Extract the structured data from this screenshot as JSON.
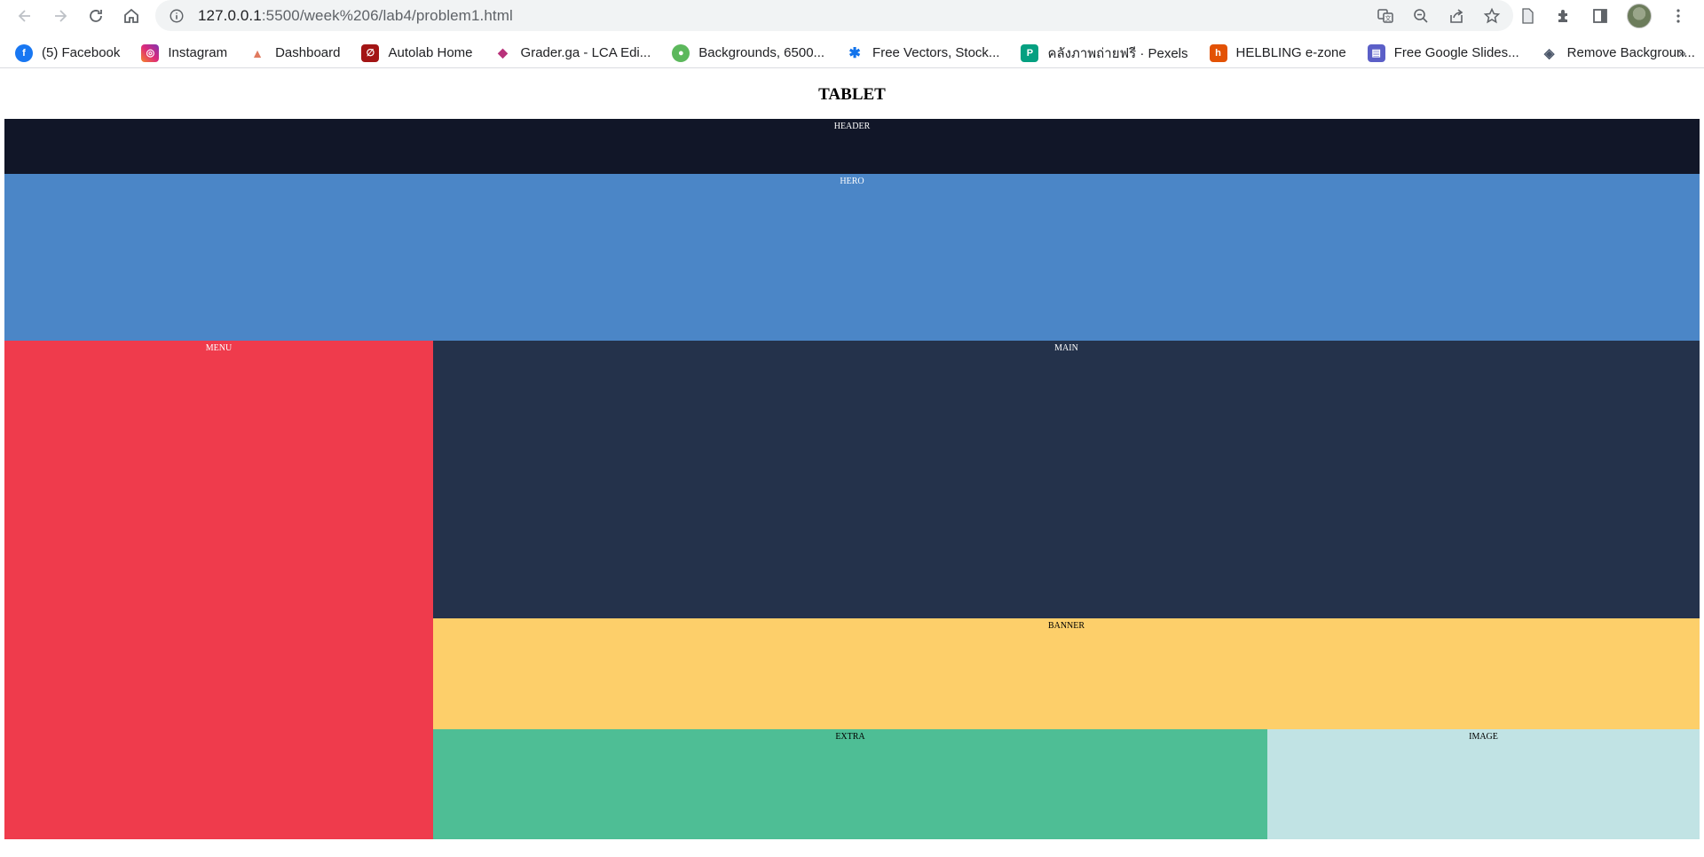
{
  "browser": {
    "url_host": "127.0.0.1",
    "url_rest": ":5500/week%206/lab4/problem1.html"
  },
  "bookmarks": [
    {
      "label": "(5) Facebook",
      "icon": "facebook-icon",
      "color": "#1877f2",
      "glyph": "f"
    },
    {
      "label": "Instagram",
      "icon": "instagram-icon",
      "color": "#d6249f",
      "glyph": "◎"
    },
    {
      "label": "Dashboard",
      "icon": "dashboard-icon",
      "color": "#e07a5f",
      "glyph": "▲"
    },
    {
      "label": "Autolab Home",
      "icon": "autolab-icon",
      "color": "#a31515",
      "glyph": "∅"
    },
    {
      "label": "Grader.ga - LCA Edi...",
      "icon": "grader-icon",
      "color": "#b8327a",
      "glyph": "◆"
    },
    {
      "label": "Backgrounds, 6500...",
      "icon": "backgrounds-icon",
      "color": "#5cb85c",
      "glyph": "●"
    },
    {
      "label": "Free Vectors, Stock...",
      "icon": "freepik-icon",
      "color": "#1273eb",
      "glyph": "✱"
    },
    {
      "label": "คลังภาพถ่ายฟรี · Pexels",
      "icon": "pexels-icon",
      "color": "#05a081",
      "glyph": "P"
    },
    {
      "label": "HELBLING e-zone",
      "icon": "helbling-icon",
      "color": "#e35205",
      "glyph": "h"
    },
    {
      "label": "Free Google Slides...",
      "icon": "slides-icon",
      "color": "#5b5fc7",
      "glyph": "▤"
    },
    {
      "label": "Remove Backgroun...",
      "icon": "remove-bg-icon",
      "color": "#4a5568",
      "glyph": "◈"
    }
  ],
  "page": {
    "title": "TABLET",
    "areas": {
      "header": "HEADER",
      "hero": "HERO",
      "menu": "MENU",
      "main": "MAIN",
      "banner": "BANNER",
      "extra": "EXTRA",
      "image": "IMAGE"
    },
    "colors": {
      "header": "#111628",
      "hero": "#4b86c7",
      "menu": "#ef3b4c",
      "main": "#24324b",
      "banner": "#fdcf6a",
      "extra": "#4ebe95",
      "image": "#c1e3e4"
    }
  }
}
